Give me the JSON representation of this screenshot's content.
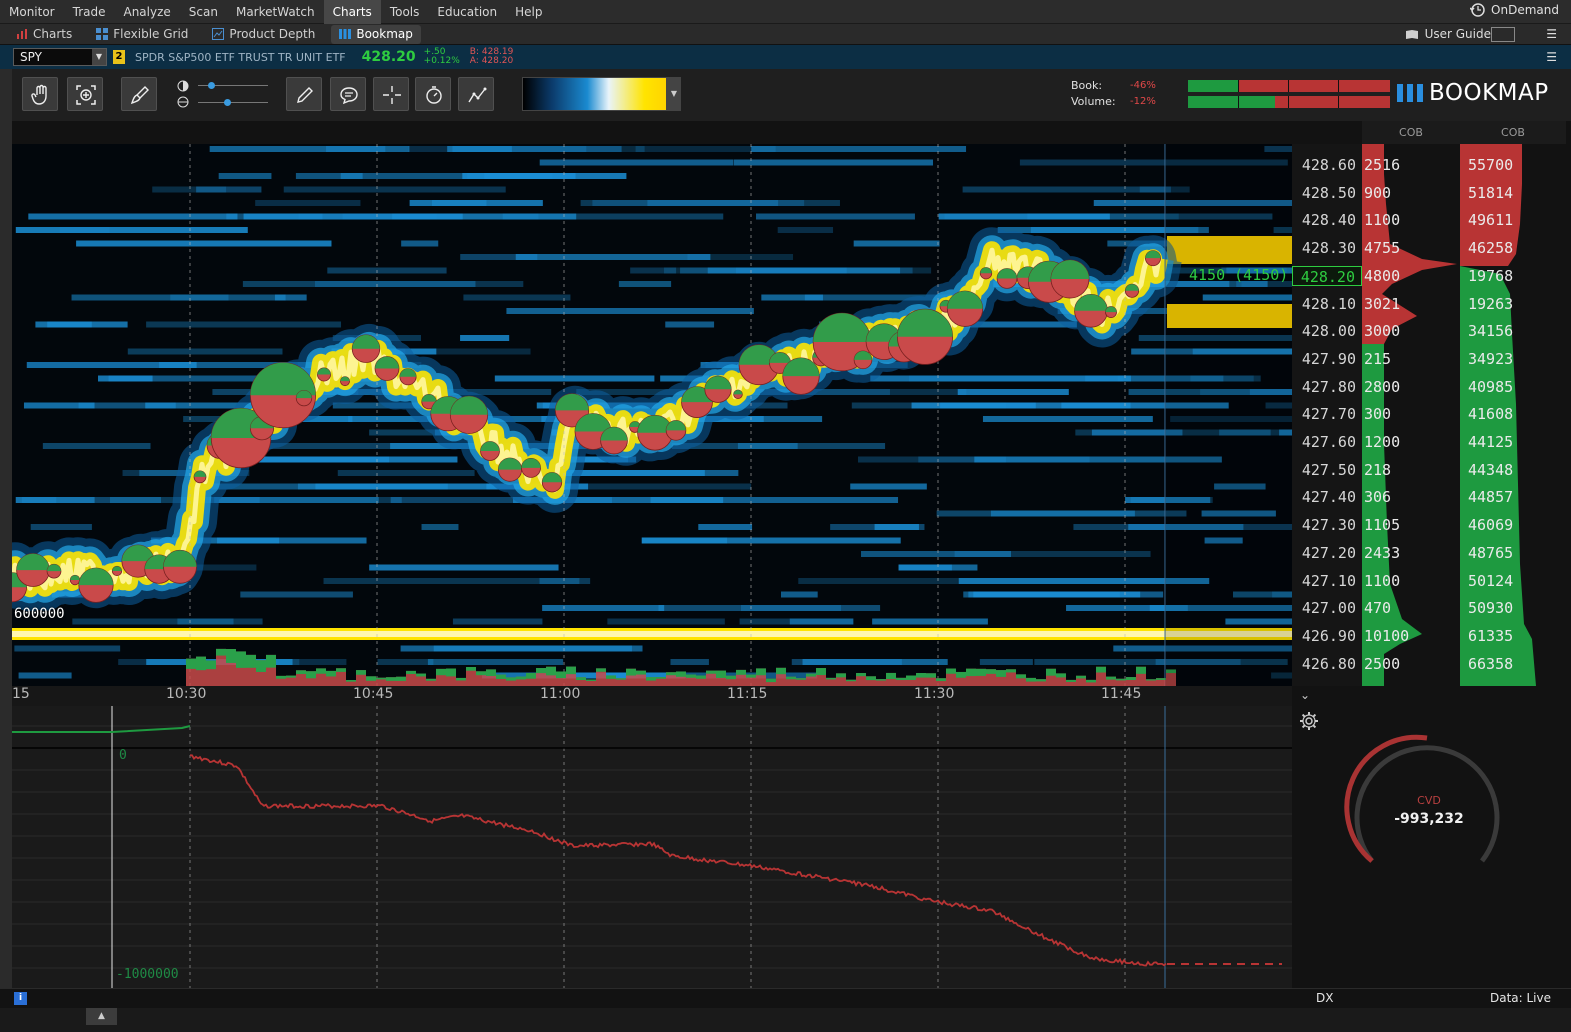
{
  "menu": [
    "Monitor",
    "Trade",
    "Analyze",
    "Scan",
    "MarketWatch",
    "Charts",
    "Tools",
    "Education",
    "Help"
  ],
  "menu_active": "Charts",
  "ondemand_label": "OnDemand",
  "subtabs": [
    {
      "label": "Charts",
      "icon": "chart-icon",
      "active": false
    },
    {
      "label": "Flexible Grid",
      "icon": "grid-icon",
      "active": false
    },
    {
      "label": "Product Depth",
      "icon": "depth-icon",
      "active": false
    },
    {
      "label": "Bookmap",
      "icon": "bookmap-icon",
      "active": true
    }
  ],
  "user_guide": "User Guide",
  "symbol": {
    "ticker": "SPY",
    "link_badge": "2",
    "description": "SPDR S&P500 ETF TRUST TR UNIT ETF",
    "last": "428.20",
    "change": "+.50",
    "change_pct": "+0.12%",
    "bid": "B: 428.19",
    "ask": "A: 428.20"
  },
  "imbalance": {
    "book_label": "Book:",
    "book_value": "-46%",
    "volume_label": "Volume:",
    "volume_value": "-12%"
  },
  "logo_text": "BOOKMAP",
  "colors": {
    "buy": "#1e9a40",
    "sell": "#b83434",
    "accent": "#2ecc40",
    "heat_high": "#ffe400",
    "heat_mid": "#1a8ad0"
  },
  "time_axis": {
    "labels": [
      "15",
      "10:30",
      "10:45",
      "11:00",
      "11:15",
      "11:30",
      "11:45"
    ]
  },
  "ladder": {
    "prices": [
      "428.60",
      "428.50",
      "428.40",
      "428.30",
      "428.20",
      "428.10",
      "428.00",
      "427.90",
      "427.80",
      "427.70",
      "427.60",
      "427.50",
      "427.40",
      "427.30",
      "427.20",
      "427.10",
      "427.00",
      "426.90",
      "426.80"
    ],
    "current_price": "428.20",
    "cob1_header": "COB",
    "cob2_header": "COB",
    "cob1": [
      "2516",
      "900",
      "1100",
      "4755",
      "4800",
      "3021",
      "3000",
      "215",
      "2800",
      "300",
      "1200",
      "218",
      "306",
      "1105",
      "2433",
      "1100",
      "470",
      "10100",
      "2500"
    ],
    "cob2": [
      "55700",
      "51814",
      "49611",
      "46258",
      "19768",
      "19263",
      "34156",
      "34923",
      "40985",
      "41608",
      "44125",
      "44348",
      "44857",
      "46069",
      "48765",
      "50124",
      "50930",
      "61335",
      "66358"
    ]
  },
  "overlay_price_text": "4150 (4150)",
  "level_label": "600000",
  "cvd": {
    "label": "CVD",
    "value": "-993,232",
    "axis_zero": "0",
    "axis_min": "-1000000"
  },
  "status": {
    "dx": "DX",
    "data": "Data: Live"
  }
}
